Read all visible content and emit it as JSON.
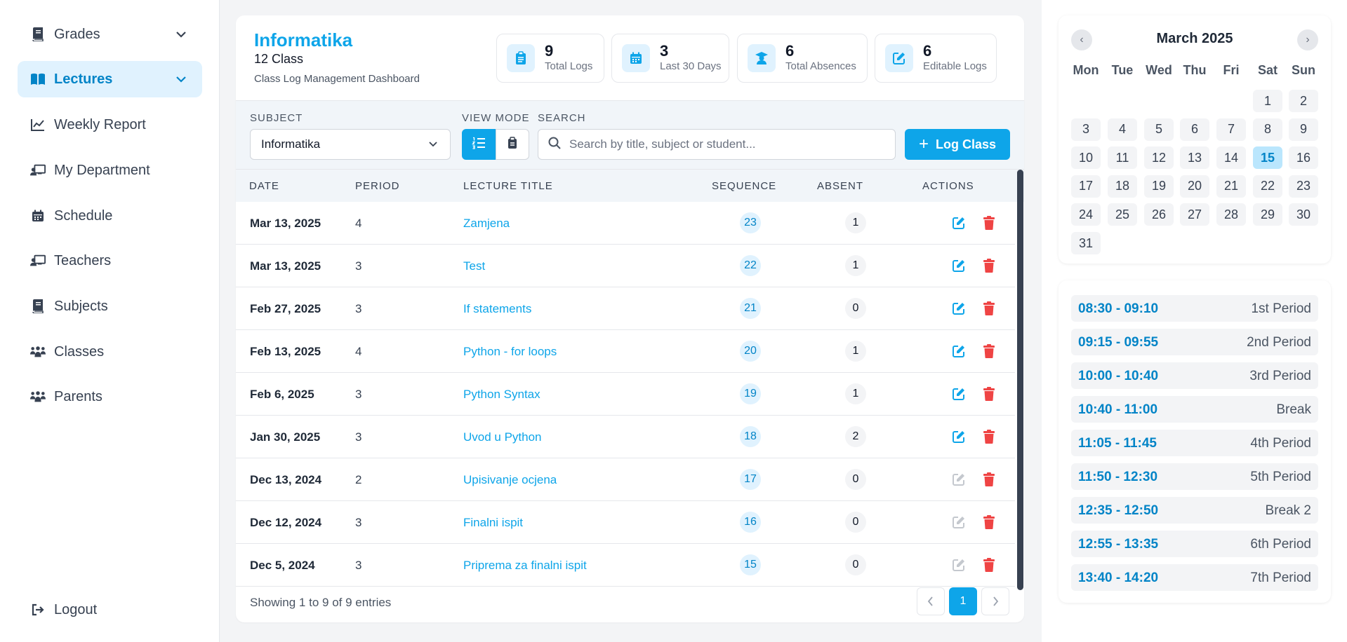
{
  "sidebar": {
    "items": [
      {
        "label": "Grades",
        "icon": "book-icon",
        "expandable": true
      },
      {
        "label": "Lectures",
        "icon": "book-open-icon",
        "expandable": true,
        "active": true
      },
      {
        "label": "Weekly Report",
        "icon": "chart-line-icon"
      },
      {
        "label": "My Department",
        "icon": "chalkboard-teacher-icon"
      },
      {
        "label": "Schedule",
        "icon": "calendar-icon"
      },
      {
        "label": "Teachers",
        "icon": "chalkboard-teacher-icon"
      },
      {
        "label": "Subjects",
        "icon": "book-icon"
      },
      {
        "label": "Classes",
        "icon": "users-icon"
      },
      {
        "label": "Parents",
        "icon": "users-icon"
      }
    ],
    "logout_label": "Logout"
  },
  "header": {
    "subject": "Informatika",
    "class_name": "12 Class",
    "subtitle": "Class Log Management Dashboard",
    "stats": [
      {
        "value": "9",
        "label": "Total Logs",
        "icon": "clipboard-icon"
      },
      {
        "value": "3",
        "label": "Last 30 Days",
        "icon": "calendar-icon"
      },
      {
        "value": "6",
        "label": "Total Absences",
        "icon": "user-graduate-icon"
      },
      {
        "value": "6",
        "label": "Editable Logs",
        "icon": "edit-icon"
      }
    ]
  },
  "filters": {
    "subject_label": "SUBJECT",
    "subject_value": "Informatika",
    "view_mode_label": "VIEW MODE",
    "search_label": "SEARCH",
    "search_placeholder": "Search by title, subject or student...",
    "log_button": "Log Class"
  },
  "table": {
    "columns": [
      "DATE",
      "PERIOD",
      "LECTURE TITLE",
      "SEQUENCE",
      "ABSENT",
      "ACTIONS"
    ],
    "rows": [
      {
        "date": "Mar 13, 2025",
        "period": "4",
        "title": "Zamjena",
        "sequence": "23",
        "absent": "1",
        "editable": true
      },
      {
        "date": "Mar 13, 2025",
        "period": "3",
        "title": "Test",
        "sequence": "22",
        "absent": "1",
        "editable": true
      },
      {
        "date": "Feb 27, 2025",
        "period": "3",
        "title": "If statements",
        "sequence": "21",
        "absent": "0",
        "editable": true
      },
      {
        "date": "Feb 13, 2025",
        "period": "4",
        "title": "Python - for loops",
        "sequence": "20",
        "absent": "1",
        "editable": true
      },
      {
        "date": "Feb 6, 2025",
        "period": "3",
        "title": "Python Syntax",
        "sequence": "19",
        "absent": "1",
        "editable": true
      },
      {
        "date": "Jan 30, 2025",
        "period": "3",
        "title": "Uvod u Python",
        "sequence": "18",
        "absent": "2",
        "editable": true
      },
      {
        "date": "Dec 13, 2024",
        "period": "2",
        "title": "Upisivanje ocjena",
        "sequence": "17",
        "absent": "0",
        "editable": false
      },
      {
        "date": "Dec 12, 2024",
        "period": "3",
        "title": "Finalni ispit",
        "sequence": "16",
        "absent": "0",
        "editable": false
      },
      {
        "date": "Dec 5, 2024",
        "period": "3",
        "title": "Priprema za finalni ispit",
        "sequence": "15",
        "absent": "0",
        "editable": false
      }
    ],
    "showing": "Showing 1 to 9 of 9 entries",
    "current_page": "1"
  },
  "calendar": {
    "title": "March 2025",
    "weekdays": [
      "Mon",
      "Tue",
      "Wed",
      "Thu",
      "Fri",
      "Sat",
      "Sun"
    ],
    "first_weekday_index": 5,
    "days_in_month": 31,
    "today": 15
  },
  "schedule": [
    {
      "time": "08:30 - 09:10",
      "name": "1st Period"
    },
    {
      "time": "09:15 - 09:55",
      "name": "2nd Period"
    },
    {
      "time": "10:00 - 10:40",
      "name": "3rd Period"
    },
    {
      "time": "10:40 - 11:00",
      "name": "Break"
    },
    {
      "time": "11:05 - 11:45",
      "name": "4th Period"
    },
    {
      "time": "11:50 - 12:30",
      "name": "5th Period"
    },
    {
      "time": "12:35 - 12:50",
      "name": "Break 2"
    },
    {
      "time": "12:55 - 13:35",
      "name": "6th Period"
    },
    {
      "time": "13:40 - 14:20",
      "name": "7th Period"
    }
  ],
  "colors": {
    "accent": "#0ea5e9",
    "accent_dark": "#0284c7",
    "danger": "#ef4444",
    "disabled": "#c4c8ce"
  }
}
